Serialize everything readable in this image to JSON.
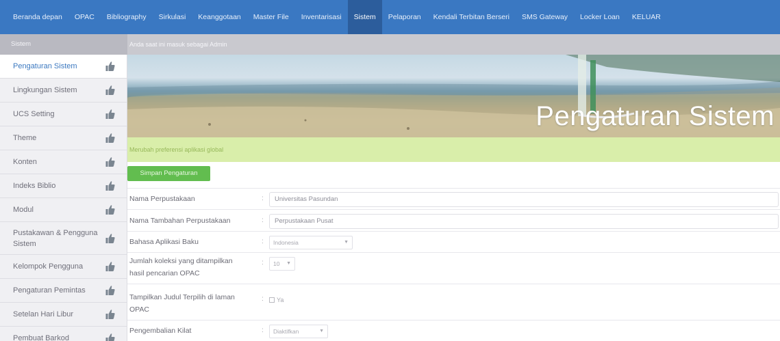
{
  "nav": {
    "items": [
      {
        "label": "Beranda depan"
      },
      {
        "label": "OPAC"
      },
      {
        "label": "Bibliography"
      },
      {
        "label": "Sirkulasi"
      },
      {
        "label": "Keanggotaan"
      },
      {
        "label": "Master File"
      },
      {
        "label": "Inventarisasi"
      },
      {
        "label": "Sistem",
        "active": true
      },
      {
        "label": "Pelaporan"
      },
      {
        "label": "Kendali Terbitan Berseri"
      },
      {
        "label": "SMS Gateway"
      },
      {
        "label": "Locker Loan"
      },
      {
        "label": "KELUAR"
      }
    ]
  },
  "subbar": {
    "section": "Sistem",
    "info": "Anda saat ini masuk sebagai Admin"
  },
  "sidebar": {
    "items": [
      {
        "label": "Pengaturan Sistem",
        "active": true
      },
      {
        "label": "Lingkungan Sistem"
      },
      {
        "label": "UCS Setting"
      },
      {
        "label": "Theme"
      },
      {
        "label": "Konten"
      },
      {
        "label": "Indeks Biblio"
      },
      {
        "label": "Modul"
      },
      {
        "label": "Pustakawan & Pengguna Sistem"
      },
      {
        "label": "Kelompok Pengguna"
      },
      {
        "label": "Pengaturan Pemintas"
      },
      {
        "label": "Setelan Hari Libur"
      },
      {
        "label": "Pembuat Barkod"
      }
    ],
    "icon": "thumbs-up-icon"
  },
  "banner": {
    "title": "Pengaturan Sistem"
  },
  "info": {
    "text": "Merubah preferensi aplikasi global"
  },
  "actions": {
    "save_label": "Simpan Pengaturan"
  },
  "form": {
    "library_name": {
      "label": "Nama Perpustakaan",
      "value": "Universitas Pasundan"
    },
    "library_subname": {
      "label": "Nama Tambahan Perpustakaan",
      "value": "Perpustakaan Pusat"
    },
    "language": {
      "label": "Bahasa Aplikasi Baku",
      "value": "Indonesia"
    },
    "results_count": {
      "label": "Jumlah koleksi yang ditampilkan hasil pencarian OPAC",
      "value": "10"
    },
    "promoted_titles": {
      "label": "Tampilkan Judul Terpilih di laman OPAC",
      "option": "Ya"
    },
    "quick_return": {
      "label": "Pengembalian Kilat",
      "value": "Diaktifkan"
    }
  },
  "colors": {
    "nav_bg": "#3a78c2",
    "nav_active": "#2c5d9c",
    "accent_text": "#3b78c0",
    "save_button": "#62bd4f",
    "info_bg": "#d9eeaa"
  }
}
